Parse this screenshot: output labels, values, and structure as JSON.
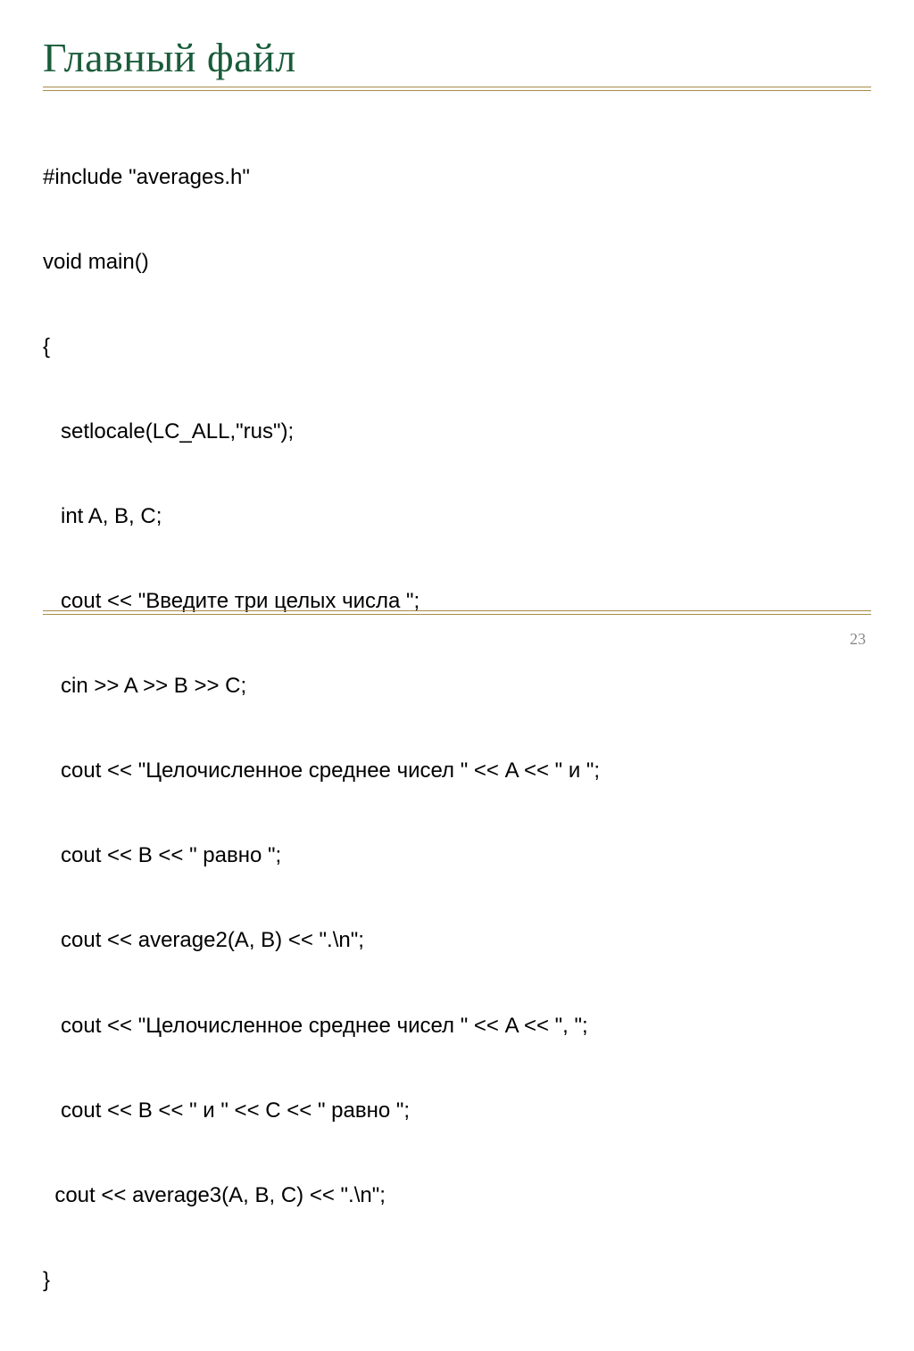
{
  "slide": {
    "title": "Главный файл",
    "code_lines": [
      "#include \"averages.h\"",
      "void main()",
      "{",
      "   setlocale(LC_ALL,\"rus\");",
      "   int A, B, C;",
      "   cout << \"Введите три целых числа \";",
      "   cin >> A >> B >> C;",
      "   cout << \"Целочисленное среднее чисел \" << A << \" и \";",
      "   cout << B << \" равно \";",
      "   cout << average2(A, B) << \".\\n\";",
      "   cout << \"Целочисленное среднее чисел \" << A << \", \";",
      "   cout << B << \" и \" << C << \" равно \";",
      "  cout << average3(A, B, C) << \".\\n\";",
      "}"
    ],
    "page_number": "23"
  }
}
